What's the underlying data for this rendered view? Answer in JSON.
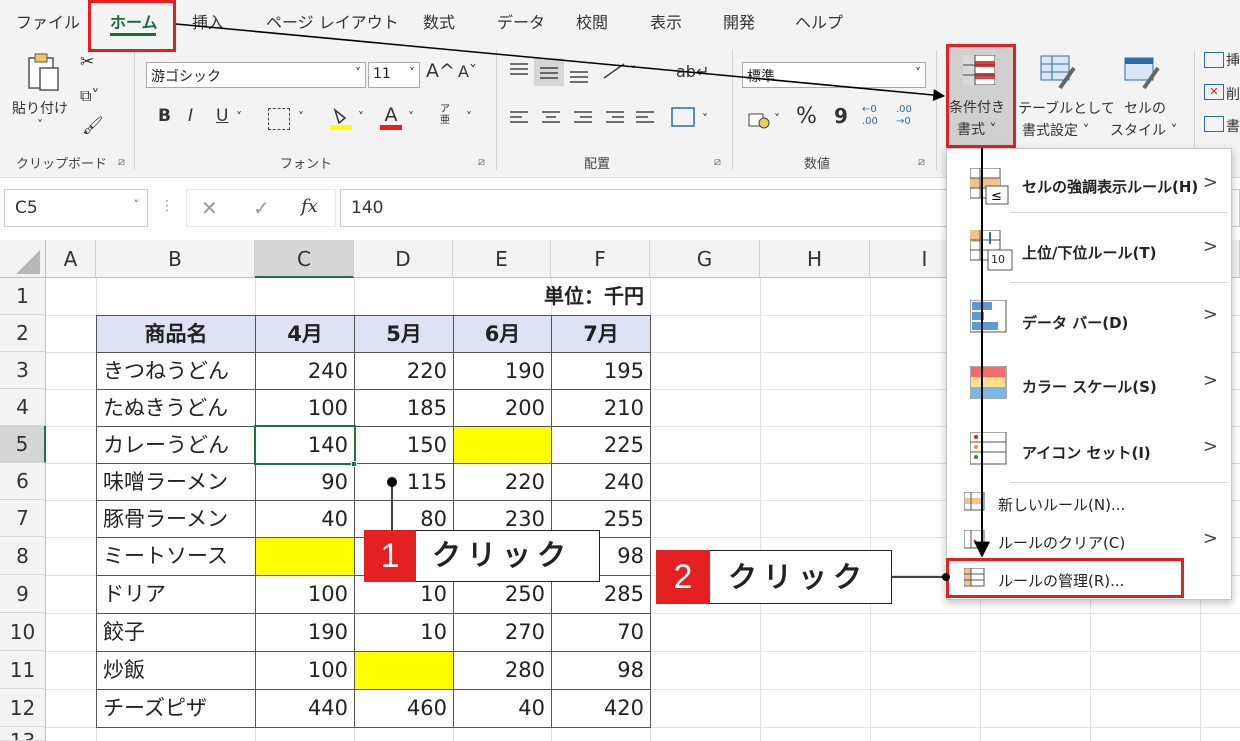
{
  "tabs": [
    "ファイル",
    "ホーム",
    "挿入",
    "ページ レイアウト",
    "数式",
    "データ",
    "校閲",
    "表示",
    "開発",
    "ヘルプ"
  ],
  "ribbon": {
    "paste_label": "貼り付け",
    "clipboard_group": "クリップボード",
    "font_name": "游ゴシック",
    "font_size": "11",
    "grow_font": "A^",
    "shrink_font": "Aˇ",
    "bold": "B",
    "italic": "I",
    "underline": "U",
    "font_color_letter": "A",
    "phonetic": "ア亜",
    "font_group": "フォント",
    "alignment_group": "配置",
    "number_format": "標準",
    "percent": "%",
    "comma": "9",
    "inc_decimal": "←0 .00",
    "dec_decimal": ".00 →0",
    "number_group": "数値",
    "cond_format_line1": "条件付き",
    "cond_format_line2": "書式 ˅",
    "table_format_line1": "テーブルとして",
    "table_format_line2": "書式設定 ˅",
    "cell_style_line1": "セルの",
    "cell_style_line2": "スタイル ˅",
    "cells_cut1": "挿",
    "cells_cut2": "削",
    "cells_cut3": "書"
  },
  "formula_bar": {
    "name_box": "C5",
    "fx": "fx",
    "value": "140",
    "cancel": "✕",
    "enter": "✓"
  },
  "columns": [
    "A",
    "B",
    "C",
    "D",
    "E",
    "F",
    "G",
    "H",
    "I"
  ],
  "rows": [
    "1",
    "2",
    "3",
    "4",
    "5",
    "6",
    "7",
    "8",
    "9",
    "10",
    "11",
    "12",
    "13"
  ],
  "sheet": {
    "unit_label": "単位：千円",
    "headers": [
      "商品名",
      "4月",
      "5月",
      "6月",
      "7月"
    ],
    "data": [
      [
        "きつねうどん",
        "240",
        "220",
        "190",
        "195"
      ],
      [
        "たぬきうどん",
        "100",
        "185",
        "200",
        "210"
      ],
      [
        "カレーうどん",
        "140",
        "150",
        "",
        "225"
      ],
      [
        "味噌ラーメン",
        "90",
        "115",
        "220",
        "240"
      ],
      [
        "豚骨ラーメン",
        "40",
        "80",
        "230",
        "255"
      ],
      [
        "ミートソース",
        "",
        "",
        "",
        "98"
      ],
      [
        "ドリア",
        "100",
        "10",
        "250",
        "285"
      ],
      [
        "餃子",
        "190",
        "10",
        "270",
        "70"
      ],
      [
        "炒飯",
        "100",
        "",
        "280",
        "98"
      ],
      [
        "チーズピザ",
        "440",
        "460",
        "40",
        "420"
      ]
    ]
  },
  "menu": {
    "highlight_rules": "セルの強調表示ルール(H)",
    "top_bottom": "上位/下位ルール(T)",
    "data_bar": "データ バー(D)",
    "color_scale": "カラー スケール(S)",
    "icon_set": "アイコン セット(I)",
    "new_rule": "新しいルール(N)...",
    "clear_rules": "ルールのクリア(C)",
    "manage_rules": "ルールの管理(R)...",
    "icon_10": "10"
  },
  "callouts": [
    {
      "num": "1",
      "text": "クリック"
    },
    {
      "num": "2",
      "text": "クリック"
    }
  ],
  "colors": {
    "accent_red": "#e52020",
    "excel_green": "#217346",
    "yellow": "#ffff00",
    "header_blue": "#dde3f3"
  }
}
